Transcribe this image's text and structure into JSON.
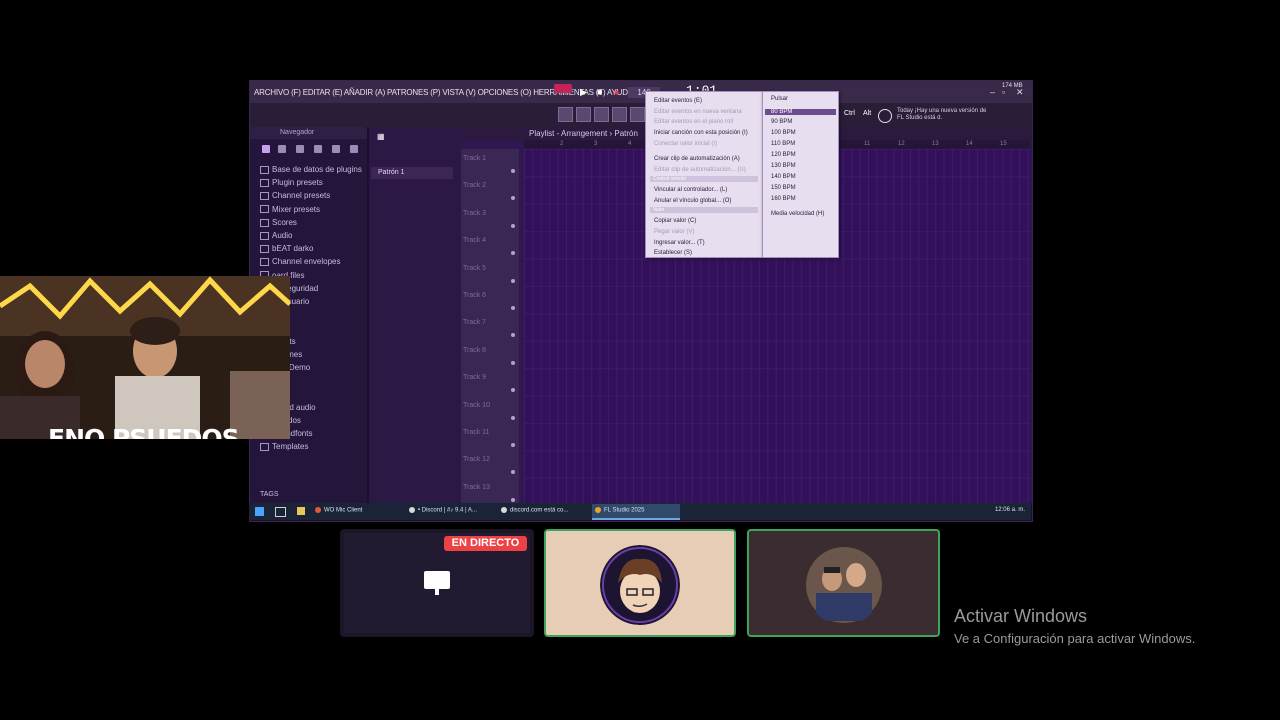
{
  "fl": {
    "menu": "ARCHIVO (F)  EDITAR (E)  AÑADIR (A)  PATRONES (P)  VISTA (V)  OPCIONES (O)  HERRAMIENTAS (T)  AYUDA",
    "tempo": "140",
    "time": "1:01",
    "memory": "174 MB",
    "hint": "Today  ¡Hay una nueva versión de FL Studio está d.",
    "ctrl_label": "Ctrl",
    "alt_label": "Alt",
    "browser_title": "Navegador",
    "browser_items": [
      "Base de datos de plugins",
      "Plugin presets",
      "Channel presets",
      "Mixer presets",
      "Scores",
      "Audio",
      "bEAT darko",
      "Channel envelopes",
      "oard files",
      "de seguridad",
      "de usuario",
      "opes",
      "ises",
      "rojects",
      "ct bones",
      "ctos Demo",
      "ded",
      "red",
      "Sliced audio",
      "Sonidos",
      "Soundfonts",
      "Templates"
    ],
    "tags_label": "TAGS",
    "pattern": "Patrón 1",
    "playlist_title": "Playlist - Arrangement › Patrón",
    "ruler": [
      "2",
      "3",
      "4",
      "11",
      "12",
      "13",
      "14",
      "15"
    ],
    "tracks": [
      "Track 1",
      "Track 2",
      "Track 3",
      "Track 4",
      "Track 5",
      "Track 6",
      "Track 7",
      "Track 8",
      "Track 9",
      "Track 10",
      "Track 11",
      "Track 12",
      "Track 13"
    ]
  },
  "context_menu": {
    "items": [
      {
        "label": "Editar eventos (E)",
        "dim": false
      },
      {
        "label": "Editar eventos en nueva ventana",
        "dim": true
      },
      {
        "label": "Editar eventos en el piano roll",
        "dim": true
      },
      {
        "label": "Iniciar canción con esta posición (I)",
        "dim": false
      },
      {
        "label": "Conectar valor inicial (I)",
        "dim": true
      },
      {
        "label": "Crear clip de automatización (A)",
        "dim": false
      },
      {
        "label": "Editar clip de automatización... (U)",
        "dim": true
      },
      {
        "label": "Vincular al controlador... (L)",
        "dim": false
      },
      {
        "label": "Anular el vínculo global... (O)",
        "dim": false
      },
      {
        "label": "Copiar valor (C)",
        "dim": false
      },
      {
        "label": "Pegar valor (V)",
        "dim": true
      },
      {
        "label": "Ingresar valor... (T)",
        "dim": false
      },
      {
        "label": "Establecer (S)",
        "dim": false
      }
    ],
    "section_global": "Control remoto",
    "section_value": "Valor"
  },
  "bpm_menu": {
    "items": [
      "Pulsar",
      "80 BPM",
      "90 BPM",
      "100 BPM",
      "110 BPM",
      "120 BPM",
      "130 BPM",
      "140 BPM",
      "150 BPM",
      "160 BPM",
      "Media velocidad (H)"
    ],
    "selected": "80 BPM"
  },
  "taskbar": {
    "tasks": [
      "WO Mic Client",
      "• Discord | #♪ 9.4 | A...",
      "discord.com está co...",
      "FL Studio 2025"
    ],
    "clock": "12:06 a. m."
  },
  "webcam": {
    "name": "ENO PSUEDOS"
  },
  "discord": {
    "live_label": "EN DIRECTO"
  },
  "windows": {
    "activate_title": "Activar Windows",
    "activate_sub": "Ve a Configuración para activar Windows."
  },
  "colors": {
    "accent_live": "#ed4245",
    "speaking_border": "#3ba55c",
    "playlist_bg": "#33115a"
  }
}
